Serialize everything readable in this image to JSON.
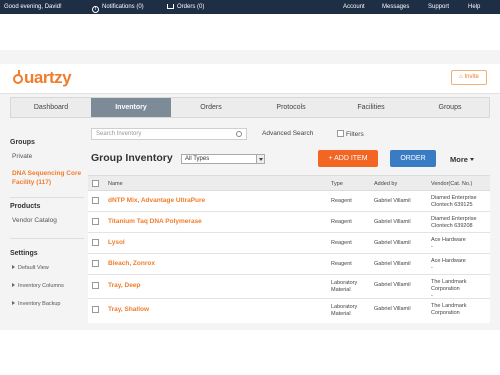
{
  "topbar": {
    "greeting": "Good evening, David!",
    "notifications": "Notifications (0)",
    "orders": "Orders (0)",
    "account": "Account",
    "messages": "Messages",
    "support": "Support",
    "help": "Help"
  },
  "header": {
    "logo": "uartzy",
    "invite": "Invite"
  },
  "nav": {
    "tabs": [
      "Dashboard",
      "Inventory",
      "Orders",
      "Protocols",
      "Facilities",
      "Groups"
    ]
  },
  "sidebar": {
    "groups_heading": "Groups",
    "groups": [
      "Private",
      "DNA Sequencing Core Facility (117)"
    ],
    "products_heading": "Products",
    "products": [
      "Vendor Catalog"
    ],
    "settings_heading": "Settings",
    "settings": [
      "Default View",
      "Inventory Columns",
      "Inventory Backup"
    ]
  },
  "toolbar": {
    "search_placeholder": "Search Inventory",
    "advanced_search": "Advanced Search",
    "filters": "Filters"
  },
  "inventory": {
    "title": "Group Inventory",
    "type_filter": "All Types",
    "add_item": "+ ADD ITEM",
    "order": "ORDER",
    "more": "More"
  },
  "table": {
    "columns": [
      "Name",
      "Type",
      "Added by",
      "Vendor(Cat. No.)"
    ],
    "rows": [
      {
        "name": "dNTP Mix, Advantage UltraPure",
        "type": "Reagent",
        "added_by": "Gabriel Villamil",
        "vendor": "Diamed Enterprise",
        "cat": "Clontech 639125"
      },
      {
        "name": "Titanium Taq DNA Polymerase",
        "type": "Reagent",
        "added_by": "Gabriel Villamil",
        "vendor": "Diamed Enterprise",
        "cat": "Clontech 639208"
      },
      {
        "name": "Lysol",
        "type": "Reagent",
        "added_by": "Gabriel Villamil",
        "vendor": "Ace Hardware",
        "cat": "-"
      },
      {
        "name": "Bleach, Zonrox",
        "type": "Reagent",
        "added_by": "Gabriel Villamil",
        "vendor": "Ace Hardware",
        "cat": "-"
      },
      {
        "name": "Tray, Deep",
        "type": "Laboratory Material",
        "added_by": "Gabriel Villamil",
        "vendor": "The Landmark Corporation",
        "cat": "-"
      },
      {
        "name": "Tray, Shallow",
        "type": "Laboratory Material",
        "added_by": "Gabriel Villamil",
        "vendor": "The Landmark Corporation",
        "cat": ""
      }
    ]
  },
  "colors": {
    "topbar": "#1d2e45",
    "accent": "#f07d2c",
    "add_button": "#f26522",
    "order_button": "#3a7cc4",
    "active_tab": "#7d8a97"
  }
}
